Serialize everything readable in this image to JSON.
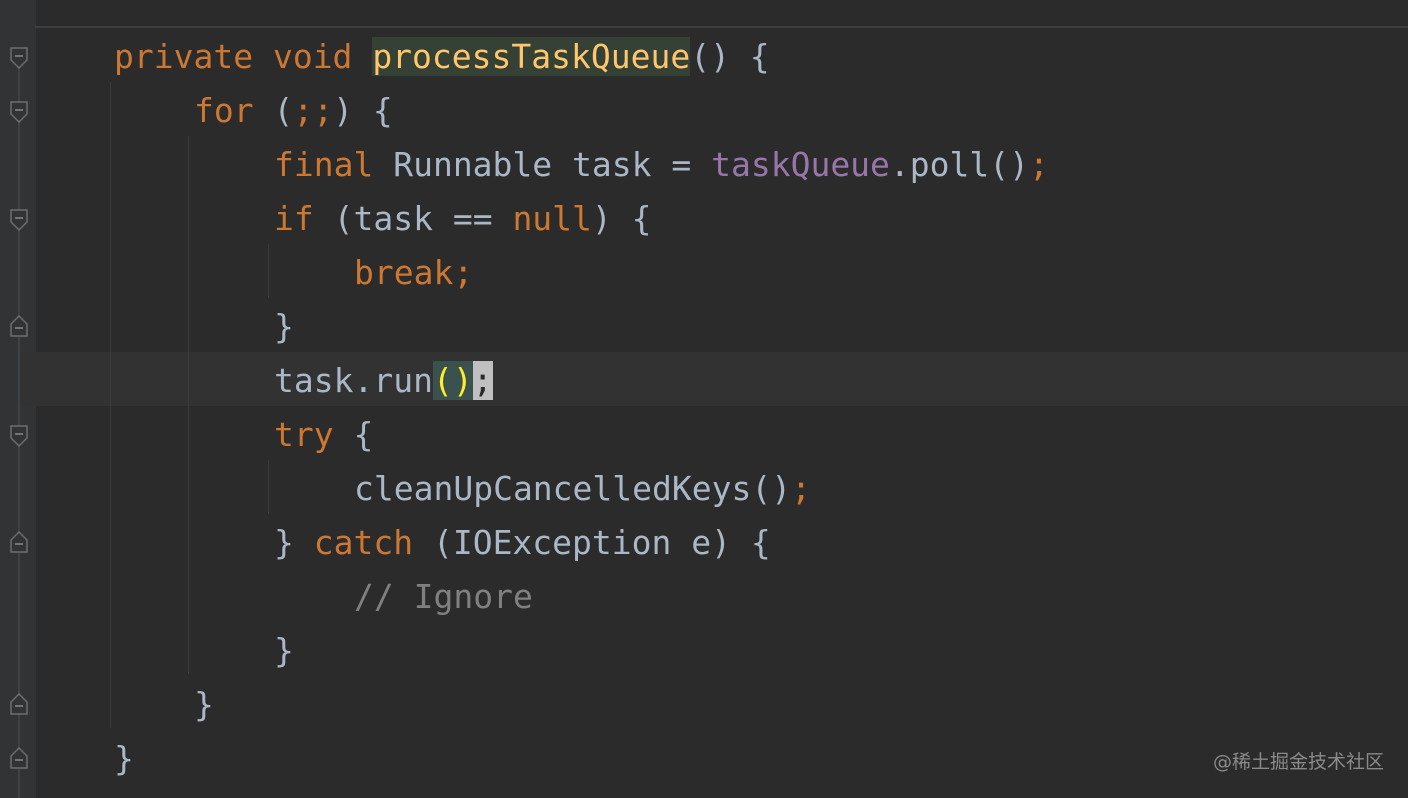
{
  "editor": {
    "language": "java",
    "lines": [
      {
        "id": "l1",
        "tokens": [
          {
            "t": "private",
            "k": "kw"
          },
          {
            "t": " ",
            "k": "plain"
          },
          {
            "t": "void",
            "k": "kw"
          },
          {
            "t": " ",
            "k": "plain"
          },
          {
            "t": "processTaskQueue",
            "k": "fn hl-method"
          },
          {
            "t": "() {",
            "k": "plain"
          }
        ]
      },
      {
        "id": "l2",
        "tokens": [
          {
            "t": "for",
            "k": "kw"
          },
          {
            "t": " (",
            "k": "plain"
          },
          {
            "t": ";;",
            "k": "kw"
          },
          {
            "t": ") {",
            "k": "plain"
          }
        ]
      },
      {
        "id": "l3",
        "tokens": [
          {
            "t": "final",
            "k": "kw"
          },
          {
            "t": " Runnable task = ",
            "k": "plain"
          },
          {
            "t": "taskQueue",
            "k": "field"
          },
          {
            "t": ".poll()",
            "k": "plain"
          },
          {
            "t": ";",
            "k": "kw"
          }
        ]
      },
      {
        "id": "l4",
        "tokens": [
          {
            "t": "if",
            "k": "kw"
          },
          {
            "t": " (task == ",
            "k": "plain"
          },
          {
            "t": "null",
            "k": "kw"
          },
          {
            "t": ") {",
            "k": "plain"
          }
        ]
      },
      {
        "id": "l5",
        "tokens": [
          {
            "t": "break;",
            "k": "kw"
          }
        ]
      },
      {
        "id": "l6",
        "tokens": [
          {
            "t": "}",
            "k": "plain"
          }
        ]
      },
      {
        "id": "l7",
        "tokens": [
          {
            "t": "task.run",
            "k": "plain"
          },
          {
            "t": "()",
            "k": "paren-match"
          },
          {
            "t": ";",
            "k": "semi-caret"
          }
        ]
      },
      {
        "id": "l8",
        "tokens": [
          {
            "t": "try",
            "k": "kw"
          },
          {
            "t": " {",
            "k": "plain"
          }
        ]
      },
      {
        "id": "l9",
        "tokens": [
          {
            "t": "cleanUpCancelledKeys()",
            "k": "plain"
          },
          {
            "t": ";",
            "k": "kw"
          }
        ]
      },
      {
        "id": "l10",
        "tokens": [
          {
            "t": "} ",
            "k": "plain"
          },
          {
            "t": "catch",
            "k": "kw"
          },
          {
            "t": " (IOException e) {",
            "k": "plain"
          }
        ]
      },
      {
        "id": "l11",
        "tokens": [
          {
            "t": "// Ignore",
            "k": "cm"
          }
        ]
      },
      {
        "id": "l12",
        "tokens": [
          {
            "t": "}",
            "k": "plain"
          }
        ]
      },
      {
        "id": "l13",
        "tokens": [
          {
            "t": "}",
            "k": "plain"
          }
        ]
      },
      {
        "id": "l14",
        "tokens": [
          {
            "t": "}",
            "k": "plain"
          }
        ]
      }
    ]
  },
  "watermark": "@稀土掘金技术社区",
  "colors": {
    "background": "#2b2b2b",
    "keyword": "#cc7832",
    "method": "#ffc66d",
    "field": "#9876aa",
    "comment": "#808080",
    "text": "#a9b7c6"
  }
}
